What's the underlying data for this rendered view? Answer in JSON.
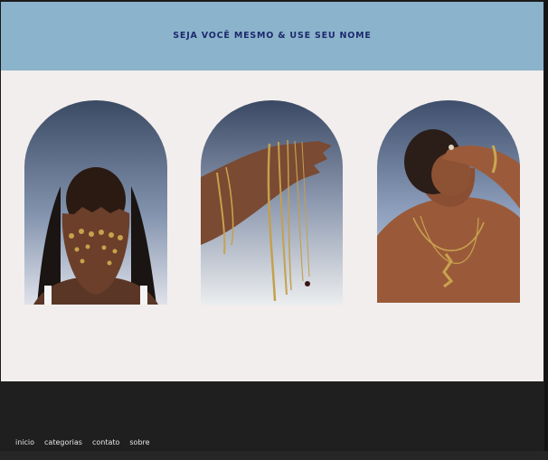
{
  "hero": {
    "title": "Seja você mesmo & use seu nome"
  },
  "gallery": {
    "images": [
      {
        "name": "woman-hands-rings"
      },
      {
        "name": "hand-holding-necklaces"
      },
      {
        "name": "man-back-necklaces"
      }
    ]
  },
  "footer": {
    "nav": [
      "inicio",
      "categorias",
      "contato",
      "sobre"
    ]
  },
  "colors": {
    "hero_bg": "#8cb3cc",
    "hero_text": "#1c2a6d",
    "gallery_bg": "#f2eeed",
    "footer_bg": "#1f1f1f"
  }
}
